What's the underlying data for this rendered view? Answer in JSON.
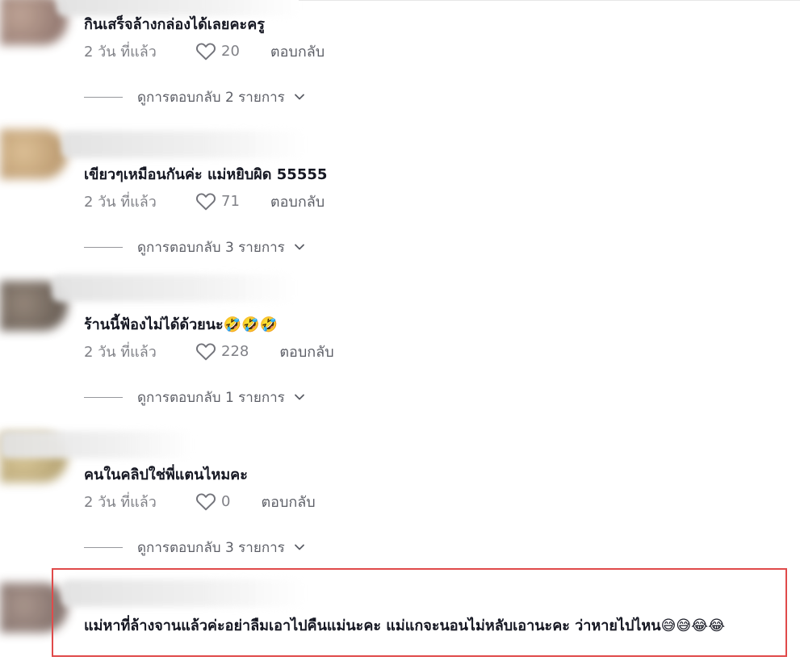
{
  "comments": [
    {
      "text": "กินเสร็จล้างกล่องได้เลยคะครู",
      "time": "2 วัน ที่แล้ว",
      "likes": "20",
      "reply_label": "ตอบกลับ",
      "view_replies": "ดูการตอบกลับ 2 รายการ"
    },
    {
      "text": "เขียวๆเหมือนกันค่ะ แม่หยิบผิด 55555",
      "time": "2 วัน ที่แล้ว",
      "likes": "71",
      "reply_label": "ตอบกลับ",
      "view_replies": "ดูการตอบกลับ 3 รายการ"
    },
    {
      "text": "ร้านนี้ฟ้องไม่ได้ด้วยนะ🤣🤣🤣",
      "time": "2 วัน ที่แล้ว",
      "likes": "228",
      "reply_label": "ตอบกลับ",
      "view_replies": "ดูการตอบกลับ 1 รายการ"
    },
    {
      "text": "คนในคลิปใช่พี่แตนไหมคะ",
      "time": "2 วัน ที่แล้ว",
      "likes": "0",
      "reply_label": "ตอบกลับ",
      "view_replies": "ดูการตอบกลับ 3 รายการ"
    },
    {
      "text": "แม่หาที่ล้างจานแล้วค่ะอย่าลืมเอาไปคืนแม่นะคะ แม่แกจะนอนไม่หลับเอานะคะ ว่าหายไปไหน😅😅😂😂"
    }
  ],
  "icons": {
    "like": "heart-outline-icon",
    "expand": "chevron-down-icon"
  },
  "colors": {
    "text_primary": "#161823",
    "text_secondary": "#8a8b91",
    "highlight": "#e04a4a"
  }
}
